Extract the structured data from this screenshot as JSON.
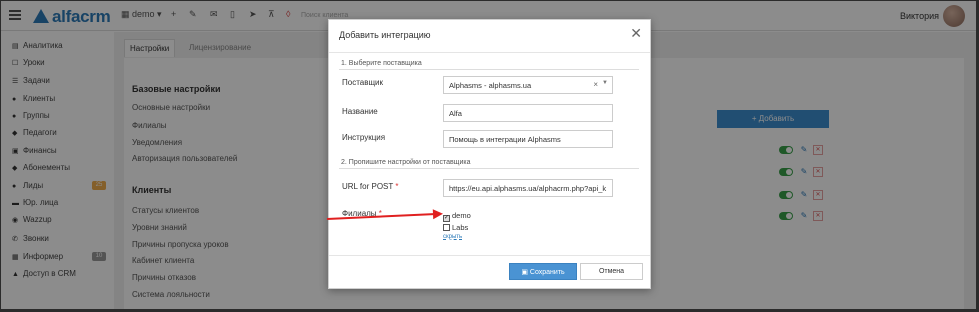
{
  "app": {
    "logo_text": "alfacrm",
    "branch_selector": "demo",
    "search_placeholder": "Поиск клиента",
    "user_name": "Виктория"
  },
  "sidebar": {
    "items": [
      {
        "label": "Аналитика",
        "icon": "chart-icon"
      },
      {
        "label": "Уроки",
        "icon": "square-icon"
      },
      {
        "label": "Задачи",
        "icon": "tasks-icon"
      },
      {
        "label": "Клиенты",
        "icon": "user-icon"
      },
      {
        "label": "Группы",
        "icon": "users-icon"
      },
      {
        "label": "Педагоги",
        "icon": "graduation-icon"
      },
      {
        "label": "Финансы",
        "icon": "money-icon"
      },
      {
        "label": "Абонементы",
        "icon": "tag-icon"
      },
      {
        "label": "Лиды",
        "icon": "leads-icon",
        "badge": "25"
      },
      {
        "label": "Юр. лица",
        "icon": "car-icon"
      },
      {
        "label": "Wazzup",
        "icon": "whatsapp-icon"
      },
      {
        "label": "Звонки",
        "icon": "phone-icon"
      },
      {
        "label": "Информер",
        "icon": "info-icon",
        "badge": "10"
      },
      {
        "label": "Доступ в CRM",
        "icon": "lock-icon"
      }
    ],
    "badge_color": "#f0ad4e",
    "badge2_color": "#9a9a9a"
  },
  "main": {
    "tabs": [
      {
        "label": "Настройки"
      },
      {
        "label": "Лицензирование"
      }
    ],
    "section_basic": "Базовые настройки",
    "basic_links": [
      "Основные настройки",
      "Филиалы",
      "Уведомления",
      "Авторизация пользователей"
    ],
    "section_clients": "Клиенты",
    "client_links": [
      "Статусы клиентов",
      "Уровни знаний",
      "Причины пропуска уроков",
      "Кабинет клиента",
      "Причины отказов",
      "Система лояльности"
    ],
    "add_button": "+ Добавить"
  },
  "modal": {
    "title": "Добавить интеграцию",
    "step1": "1. Выберите поставщика",
    "provider_label": "Поставщик",
    "provider_value": "Alphasms - alphasms.ua",
    "name_label": "Название",
    "name_value": "Alfa",
    "instruction_label": "Инструкция",
    "instruction_value": "Помощь в интеграции Alphasms",
    "step2": "2. Пропишите настройки от поставщика",
    "url_label": "URL for POST",
    "url_value": "https://eu.api.alphasms.ua/alphacrm.php?api_k",
    "branches_label": "Филиалы",
    "branches": [
      {
        "label": "demo",
        "checked": true
      },
      {
        "label": "Labs",
        "checked": false
      }
    ],
    "hide_link": "скрыть",
    "save_button": "Сохранить",
    "cancel_button": "Отмена"
  },
  "colors": {
    "accent": "#2c7ab8",
    "primary_button": "#4a93d3",
    "toggle_on": "#3aa04a",
    "annotation_arrow": "#e02020"
  }
}
